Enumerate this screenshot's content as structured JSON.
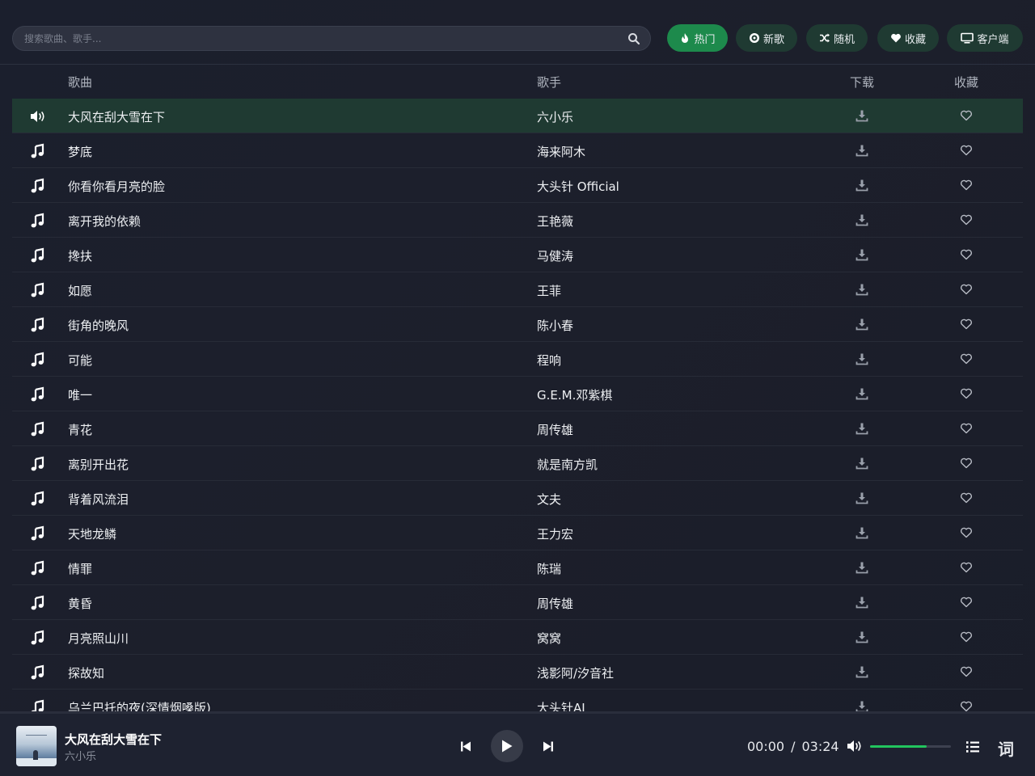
{
  "search": {
    "placeholder": "搜索歌曲、歌手..."
  },
  "nav": [
    {
      "label": "热门",
      "icon": "fire-icon",
      "active": true
    },
    {
      "label": "新歌",
      "icon": "disc-icon",
      "active": false
    },
    {
      "label": "随机",
      "icon": "shuffle-icon",
      "active": false
    },
    {
      "label": "收藏",
      "icon": "heart-icon",
      "active": false
    },
    {
      "label": "客户端",
      "icon": "monitor-icon",
      "active": false
    }
  ],
  "table": {
    "headers": {
      "song": "歌曲",
      "artist": "歌手",
      "download": "下载",
      "favorite": "收藏"
    },
    "rows": [
      {
        "title": "大风在刮大雪在下",
        "artist": "六小乐",
        "playing": true
      },
      {
        "title": "梦底",
        "artist": "海来阿木"
      },
      {
        "title": "你看你看月亮的脸",
        "artist": "大头针 Official"
      },
      {
        "title": "离开我的依赖",
        "artist": "王艳薇"
      },
      {
        "title": "搀扶",
        "artist": "马健涛"
      },
      {
        "title": "如愿",
        "artist": "王菲"
      },
      {
        "title": "街角的晚风",
        "artist": "陈小春"
      },
      {
        "title": "可能",
        "artist": "程响"
      },
      {
        "title": "唯一",
        "artist": "G.E.M.邓紫棋"
      },
      {
        "title": "青花",
        "artist": "周传雄"
      },
      {
        "title": "离别开出花",
        "artist": "就是南方凯"
      },
      {
        "title": "背着风流泪",
        "artist": "文夫"
      },
      {
        "title": "天地龙鳞",
        "artist": "王力宏"
      },
      {
        "title": "情罪",
        "artist": "陈瑞"
      },
      {
        "title": "黄昏",
        "artist": "周传雄"
      },
      {
        "title": "月亮照山川",
        "artist": "窝窝"
      },
      {
        "title": "探故知",
        "artist": "浅影阿/汐音社"
      },
      {
        "title": "乌兰巴托的夜(深情烟嗓版)",
        "artist": "大头针AI"
      }
    ]
  },
  "player": {
    "title": "大风在刮大雪在下",
    "artist": "六小乐",
    "current_time": "00:00",
    "separator": "/",
    "duration": "03:24",
    "volume": 0.7,
    "lyric_label": "词"
  },
  "colors": {
    "accent": "#1d8a4c",
    "accent_dark": "#1f3a32",
    "volume_fill": "#22c55e",
    "background": "#1c1f2b"
  }
}
